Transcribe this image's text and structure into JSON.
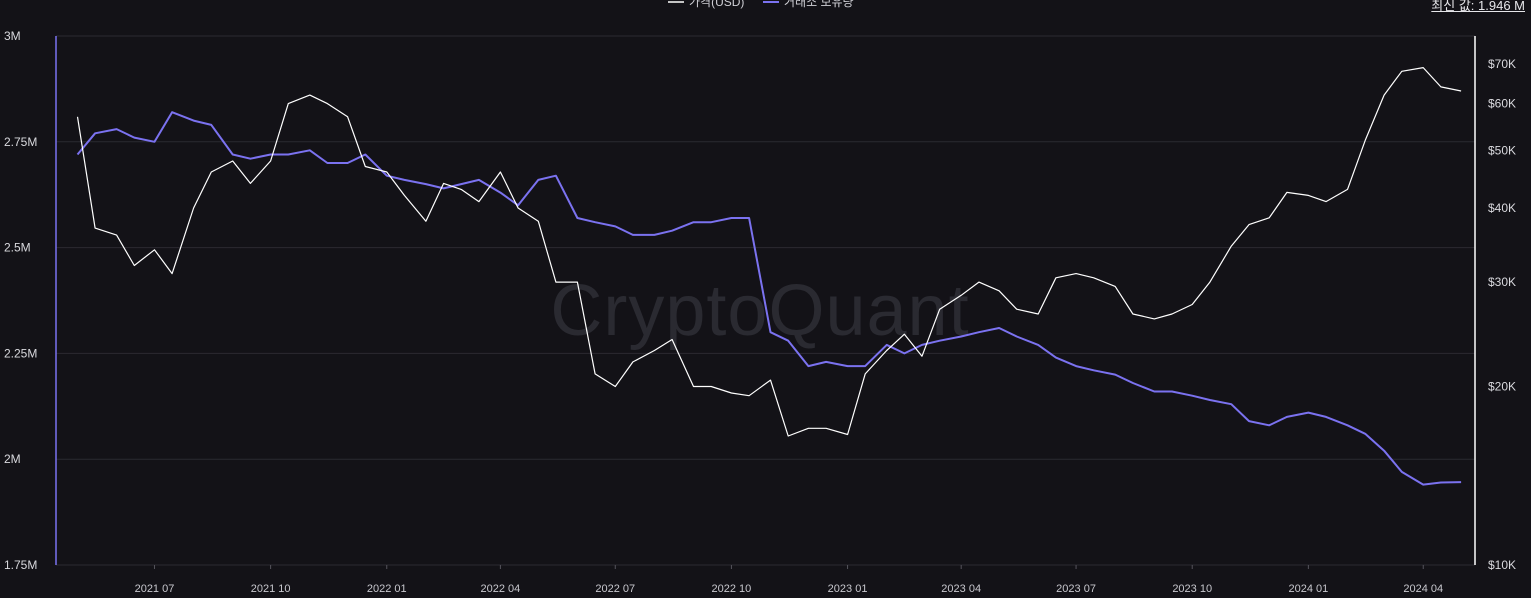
{
  "legend": {
    "price_label": "가격(USD)",
    "reserve_label": "거래소 보유량"
  },
  "latest_value": "최신 값: 1.946 M",
  "watermark": "CryptoQuant",
  "colors": {
    "background": "#131217",
    "reserve": "#7b72f0",
    "price": "#ffffff",
    "grid": "#2b2a31"
  },
  "chart_data": {
    "type": "line",
    "x": [
      "2021-05-01",
      "2021-05-15",
      "2021-06-01",
      "2021-06-15",
      "2021-07-01",
      "2021-07-15",
      "2021-08-01",
      "2021-08-15",
      "2021-09-01",
      "2021-09-15",
      "2021-10-01",
      "2021-10-15",
      "2021-11-01",
      "2021-11-15",
      "2021-12-01",
      "2021-12-15",
      "2022-01-01",
      "2022-01-15",
      "2022-02-01",
      "2022-02-15",
      "2022-03-01",
      "2022-03-15",
      "2022-04-01",
      "2022-04-15",
      "2022-05-01",
      "2022-05-15",
      "2022-06-01",
      "2022-06-15",
      "2022-07-01",
      "2022-07-15",
      "2022-08-01",
      "2022-08-15",
      "2022-09-01",
      "2022-09-15",
      "2022-10-01",
      "2022-10-15",
      "2022-11-01",
      "2022-11-15",
      "2022-12-01",
      "2022-12-15",
      "2023-01-01",
      "2023-01-15",
      "2023-02-01",
      "2023-02-15",
      "2023-03-01",
      "2023-03-15",
      "2023-04-01",
      "2023-04-15",
      "2023-05-01",
      "2023-05-15",
      "2023-06-01",
      "2023-06-15",
      "2023-07-01",
      "2023-07-15",
      "2023-08-01",
      "2023-08-15",
      "2023-09-01",
      "2023-09-15",
      "2023-10-01",
      "2023-10-15",
      "2023-11-01",
      "2023-11-15",
      "2023-12-01",
      "2023-12-15",
      "2024-01-01",
      "2024-01-15",
      "2024-02-01",
      "2024-02-15",
      "2024-03-01",
      "2024-03-15",
      "2024-04-01",
      "2024-04-15",
      "2024-05-01"
    ],
    "series": [
      {
        "name": "거래소 보유량",
        "axis": "left",
        "values": [
          2.72,
          2.77,
          2.78,
          2.76,
          2.75,
          2.82,
          2.8,
          2.79,
          2.72,
          2.71,
          2.72,
          2.72,
          2.73,
          2.7,
          2.7,
          2.72,
          2.67,
          2.66,
          2.65,
          2.64,
          2.65,
          2.66,
          2.63,
          2.6,
          2.66,
          2.67,
          2.57,
          2.56,
          2.55,
          2.53,
          2.53,
          2.54,
          2.56,
          2.56,
          2.57,
          2.57,
          2.3,
          2.28,
          2.22,
          2.23,
          2.22,
          2.22,
          2.27,
          2.25,
          2.27,
          2.28,
          2.29,
          2.3,
          2.31,
          2.29,
          2.27,
          2.24,
          2.22,
          2.21,
          2.2,
          2.18,
          2.16,
          2.16,
          2.15,
          2.14,
          2.13,
          2.09,
          2.08,
          2.1,
          2.11,
          2.1,
          2.08,
          2.06,
          2.02,
          1.97,
          1.94,
          1.945,
          1.946
        ]
      },
      {
        "name": "가격(USD)",
        "axis": "right",
        "values": [
          57000,
          37000,
          36000,
          32000,
          34000,
          31000,
          40000,
          46000,
          48000,
          44000,
          48000,
          60000,
          62000,
          60000,
          57000,
          47000,
          46000,
          42000,
          38000,
          44000,
          43000,
          41000,
          46000,
          40000,
          38000,
          30000,
          30000,
          21000,
          20000,
          22000,
          23000,
          24000,
          20000,
          20000,
          19500,
          19300,
          20500,
          16500,
          17000,
          17000,
          16600,
          21000,
          23000,
          24500,
          22500,
          27000,
          28500,
          30000,
          29000,
          27000,
          26500,
          30500,
          31000,
          30500,
          29500,
          26500,
          26000,
          26500,
          27500,
          30000,
          34500,
          37500,
          38500,
          42500,
          42000,
          41000,
          43000,
          52000,
          62000,
          68000,
          69000,
          64000,
          63000
        ]
      }
    ],
    "left_axis": {
      "ticks": [
        "1.75M",
        "2M",
        "2.25M",
        "2.5M",
        "2.75M",
        "3M"
      ],
      "min": 1.75,
      "max": 3.0,
      "unit": "M"
    },
    "right_axis": {
      "ticks": [
        "$10K",
        "$20K",
        "$30K",
        "$40K",
        "$50K",
        "$60K",
        "$70K"
      ],
      "scale": "log",
      "min": 10000,
      "max": 78000
    },
    "x_ticks": [
      "2021 07",
      "2021 10",
      "2022 01",
      "2022 04",
      "2022 07",
      "2022 10",
      "2023 01",
      "2023 04",
      "2023 07",
      "2023 10",
      "2024 01",
      "2024 04"
    ],
    "grid": true,
    "legend_position": "top-center"
  }
}
